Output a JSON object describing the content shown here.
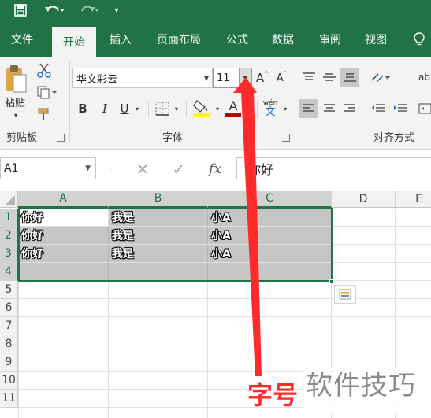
{
  "qat": {
    "save_icon": "save-icon",
    "undo_icon": "undo-icon",
    "redo_icon": "redo-icon",
    "customize_icon": "customize-icon"
  },
  "tabs": [
    {
      "label": "文件"
    },
    {
      "label": "开始"
    },
    {
      "label": "插入"
    },
    {
      "label": "页面布局"
    },
    {
      "label": "公式"
    },
    {
      "label": "数据"
    },
    {
      "label": "审阅"
    },
    {
      "label": "视图"
    }
  ],
  "ribbon": {
    "clipboard": {
      "paste_label": "粘贴",
      "group_label": "剪贴板"
    },
    "font": {
      "font_name": "华文彩云",
      "font_size": "11",
      "group_label": "字体",
      "bold": "B",
      "italic": "I",
      "underline": "U",
      "grow": "A",
      "shrink": "A",
      "font_color_letter": "A",
      "phonetic_top": "wén",
      "phonetic_bottom": "文"
    },
    "alignment": {
      "group_label": "对齐方式"
    },
    "colors": {
      "fill": "#ffff00",
      "font": "#c00000"
    }
  },
  "formula_bar": {
    "name_box": "A1",
    "fx": "fx",
    "content": "你好"
  },
  "sheet": {
    "columns": [
      "A",
      "B",
      "C",
      "D",
      "E"
    ],
    "rows": [
      "1",
      "2",
      "3",
      "4",
      "5",
      "6",
      "7",
      "8",
      "9",
      "10",
      "11"
    ],
    "cells": [
      [
        "你好",
        "我是",
        "小A"
      ],
      [
        "你好",
        "我是",
        "小A"
      ],
      [
        "你好",
        "我是",
        "小A"
      ],
      [
        "",
        "",
        ""
      ]
    ]
  },
  "annotation": {
    "text": "字号"
  },
  "watermark": {
    "text": "软件技巧"
  },
  "theme": {
    "accent": "#217346",
    "arrow": "#ff2a2a"
  }
}
